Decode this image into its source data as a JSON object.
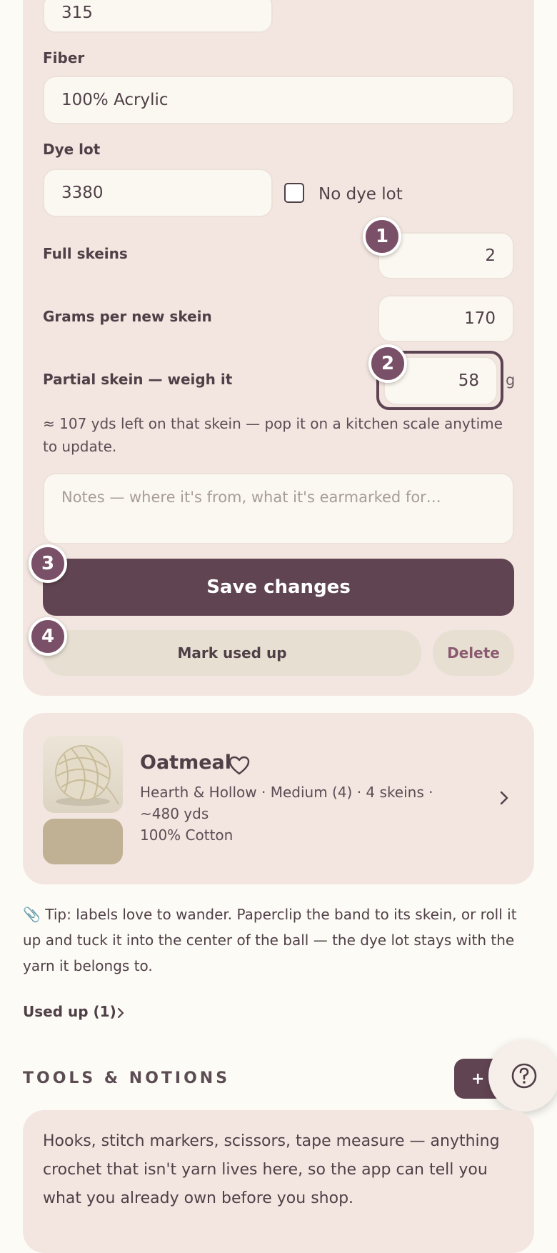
{
  "form": {
    "top_value": "315",
    "fiber_label": "Fiber",
    "fiber_value": "100% Acrylic",
    "dye_lot_label": "Dye lot",
    "dye_lot_value": "3380",
    "no_dye_lot_label": "No dye lot",
    "no_dye_lot_checked": false,
    "full_skeins_label": "Full skeins",
    "full_skeins_value": "2",
    "grams_label": "Grams per new skein",
    "grams_value": "170",
    "partial_label": "Partial skein — weigh it",
    "partial_value": "58",
    "partial_unit": "g",
    "hint": "≈ 107 yds left on that skein — pop it on a kitchen scale anytime to update.",
    "notes_placeholder": "Notes — where it's from, what it's earmarked for…",
    "save_label": "Save changes",
    "mark_used_label": "Mark used up",
    "delete_label": "Delete"
  },
  "badges": [
    "1",
    "2",
    "3",
    "4"
  ],
  "yarn_card": {
    "name": "Oatmeal",
    "meta": "Hearth & Hollow · Medium (4) · 4 skeins · ~480 yds",
    "fiber": "100% Cotton",
    "swatch_color": "#c0b094"
  },
  "tip": {
    "icon": "paperclip-icon",
    "text": "📎 Tip: labels love to wander. Paperclip the band to its skein, or roll it up and tuck it into the center of the ball — the dye lot stays with the yarn it belongs to."
  },
  "used_up_link": "Used up (1)",
  "tools": {
    "title": "TOOLS & NOTIONS",
    "add_label": "+ Add",
    "description": "Hooks, stitch markers, scissors, tape measure — anything crochet that isn't yarn lives here, so the app can tell you what you already own before you shop."
  },
  "colors": {
    "accent": "#614452",
    "badge": "#7a5068",
    "card": "#f3e6e1",
    "background": "#fdfbf6"
  }
}
